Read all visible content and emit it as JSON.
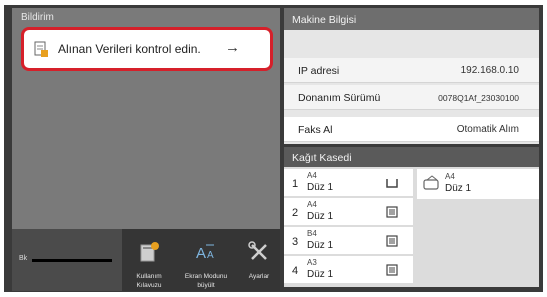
{
  "notification": {
    "title": "Bildirim",
    "message": "Alınan Verileri kontrol edin.",
    "arrow": "→"
  },
  "toner": {
    "label": "Bk",
    "level_percent": 100
  },
  "tools": [
    {
      "caption_line1": "Kullanım",
      "caption_line2": "Kılavuzu",
      "icon": "book-icon"
    },
    {
      "caption_line1": "Ekran Modunu",
      "caption_line2": "büyült",
      "icon": "text-size-icon"
    },
    {
      "caption_line1": "Ayarlar",
      "caption_line2": "",
      "icon": "wrench-screwdriver-icon"
    }
  ],
  "machine_info": {
    "title": "Makine Bilgisi",
    "rows": [
      {
        "key": "IP adresi",
        "value": "192.168.0.10"
      },
      {
        "key": "Donanım Sürümü",
        "value": "0078Q1Af_23030100"
      },
      {
        "key": "Faks Al",
        "value": "Otomatik Alım"
      }
    ]
  },
  "paper_tray": {
    "title": "Kağıt Kasedi",
    "trays": [
      {
        "num": "1",
        "size": "A4",
        "type": "Düz 1"
      },
      {
        "num": "2",
        "size": "A4",
        "type": "Düz 1"
      },
      {
        "num": "3",
        "size": "B4",
        "type": "Düz 1"
      },
      {
        "num": "4",
        "size": "A3",
        "type": "Düz 1"
      }
    ],
    "bypass": {
      "size": "A4",
      "type": "Düz 1"
    }
  },
  "colors": {
    "alert_border": "#d6202a",
    "accent_orange": "#e8a020"
  }
}
